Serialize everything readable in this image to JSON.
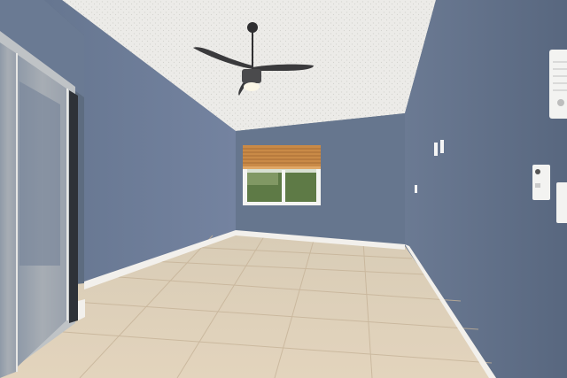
{
  "scene": {
    "kind": "photo",
    "subject": "empty-bedroom",
    "colors": {
      "wall_left": "#6e7d95",
      "wall_back": "#67778f",
      "wall_right": "#62718a",
      "ceiling": "#ecebe8",
      "floor": "#d9c8ae",
      "grout": "#c7b59a",
      "baseboard": "#f2f0ec",
      "fan": "#3a3a3c",
      "blind": "#c98a47",
      "foliage": "#5e7a46"
    },
    "objects": [
      {
        "name": "ceiling-fan-icon"
      },
      {
        "name": "window-with-blinds-icon"
      },
      {
        "name": "mirrored-closet-door-icon"
      },
      {
        "name": "light-switch-icon"
      },
      {
        "name": "thermostat-icon"
      },
      {
        "name": "wall-air-vent-icon"
      }
    ]
  }
}
